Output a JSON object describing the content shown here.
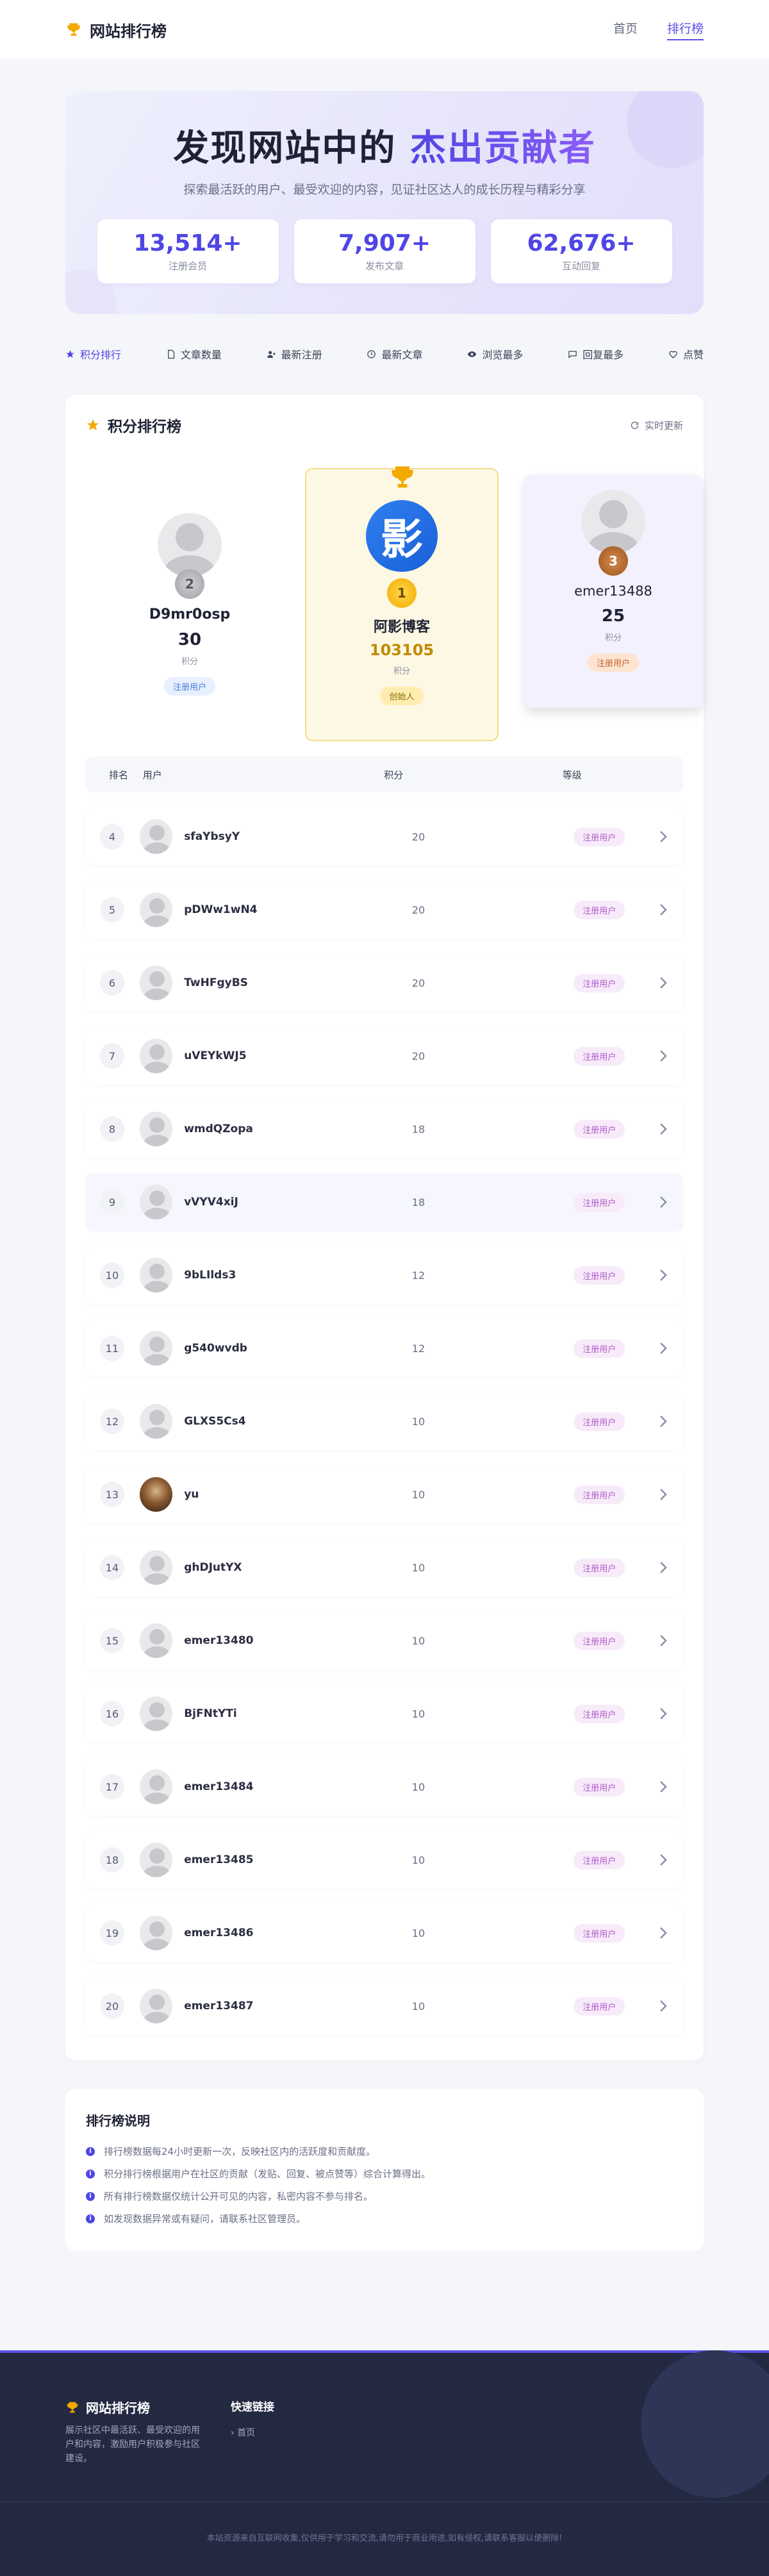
{
  "header": {
    "title": "网站排行榜",
    "nav": [
      "首页",
      "排行榜"
    ]
  },
  "hero": {
    "title_a": "发现网站中的",
    "title_b": "杰出贡献者",
    "subtitle": "探索最活跃的用户、最受欢迎的内容，见证社区达人的成长历程与精彩分享",
    "stats": [
      {
        "value": "13,514+",
        "label": "注册会员"
      },
      {
        "value": "7,907+",
        "label": "发布文章"
      },
      {
        "value": "62,676+",
        "label": "互动回复"
      }
    ]
  },
  "tabs": [
    "积分排行",
    "文章数量",
    "最新注册",
    "最新文章",
    "浏览最多",
    "回复最多",
    "点赞"
  ],
  "ranking": {
    "title": "积分排行榜",
    "refresh": "实时更新",
    "score_label": "积分",
    "podium": [
      {
        "rank": "2",
        "name": "D9mr0osp",
        "score": "30",
        "level": "注册用户"
      },
      {
        "rank": "1",
        "name": "阿影博客",
        "score": "103105",
        "level": "创始人",
        "avatar_char": "影"
      },
      {
        "rank": "3",
        "name": "emer13488",
        "score": "25",
        "level": "注册用户"
      }
    ],
    "columns": [
      "排名",
      "用户",
      "积分",
      "等级"
    ],
    "rows": [
      {
        "rank": "4",
        "name": "sfaYbsyY",
        "score": "20",
        "level": "注册用户"
      },
      {
        "rank": "5",
        "name": "pDWw1wN4",
        "score": "20",
        "level": "注册用户"
      },
      {
        "rank": "6",
        "name": "TwHFgyBS",
        "score": "20",
        "level": "注册用户"
      },
      {
        "rank": "7",
        "name": "uVEYkWJ5",
        "score": "20",
        "level": "注册用户"
      },
      {
        "rank": "8",
        "name": "wmdQZopa",
        "score": "18",
        "level": "注册用户"
      },
      {
        "rank": "9",
        "name": "vVYV4xiJ",
        "score": "18",
        "level": "注册用户"
      },
      {
        "rank": "10",
        "name": "9bLIlds3",
        "score": "12",
        "level": "注册用户"
      },
      {
        "rank": "11",
        "name": "g540wvdb",
        "score": "12",
        "level": "注册用户"
      },
      {
        "rank": "12",
        "name": "GLXS5Cs4",
        "score": "10",
        "level": "注册用户"
      },
      {
        "rank": "13",
        "name": "yu",
        "score": "10",
        "level": "注册用户"
      },
      {
        "rank": "14",
        "name": "ghDJutYX",
        "score": "10",
        "level": "注册用户"
      },
      {
        "rank": "15",
        "name": "emer13480",
        "score": "10",
        "level": "注册用户"
      },
      {
        "rank": "16",
        "name": "BjFNtYTi",
        "score": "10",
        "level": "注册用户"
      },
      {
        "rank": "17",
        "name": "emer13484",
        "score": "10",
        "level": "注册用户"
      },
      {
        "rank": "18",
        "name": "emer13485",
        "score": "10",
        "level": "注册用户"
      },
      {
        "rank": "19",
        "name": "emer13486",
        "score": "10",
        "level": "注册用户"
      },
      {
        "rank": "20",
        "name": "emer13487",
        "score": "10",
        "level": "注册用户"
      }
    ]
  },
  "info": {
    "title": "排行榜说明",
    "items": [
      "排行榜数据每24小时更新一次，反映社区内的活跃度和贡献度。",
      "积分排行榜根据用户在社区的贡献（发贴、回复、被点赞等）综合计算得出。",
      "所有排行榜数据仅统计公开可见的内容，私密内容不参与排名。",
      "如发现数据异常或有疑问，请联系社区管理员。"
    ]
  },
  "footer": {
    "title": "网站排行榜",
    "desc": "展示社区中最活跃、最受欢迎的用户和内容，激励用户积极参与社区建设。",
    "links_title": "快速链接",
    "link_home": "首页",
    "copyright": "本站资源来自互联网收集,仅供用于学习和交流,请勿用于商业用途,如有侵权,请联系客服以便删除!"
  },
  "colors": {
    "accent": "#4f46e5",
    "gold": "#f2a900",
    "footer": "#232941"
  }
}
